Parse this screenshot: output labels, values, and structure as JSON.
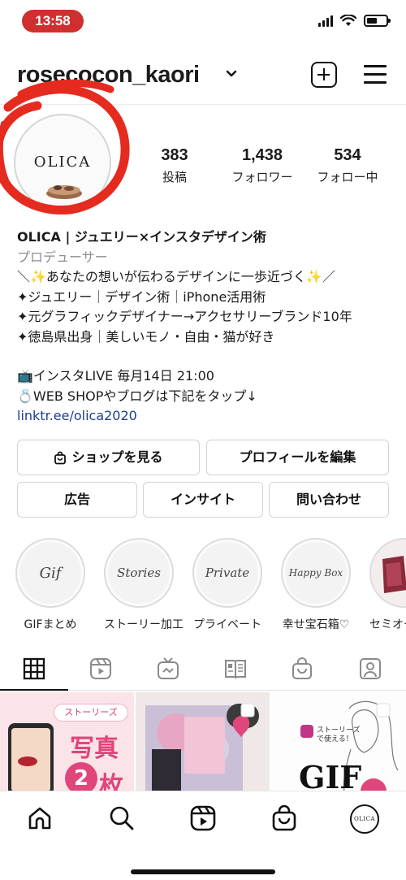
{
  "status_bar": {
    "time": "13:58"
  },
  "header": {
    "username": "rosecocon_kaori"
  },
  "avatar": {
    "text": "OLICA"
  },
  "stats": [
    {
      "value": "383",
      "label": "投稿"
    },
    {
      "value": "1,438",
      "label": "フォロワー"
    },
    {
      "value": "534",
      "label": "フォロー中"
    }
  ],
  "bio": {
    "name": "OLICA | ジュエリー×インスタデザイン術",
    "category": "プロデューサー",
    "lines": [
      "＼✨あなたの想いが伝わるデザインに一歩近づく✨／",
      "✦ジュエリー｜デザイン術｜iPhone活用術",
      "✦元グラフィックデザイナー→アクセサリーブランド10年",
      "✦徳島県出身｜美しいモノ・自由・猫が好き"
    ],
    "live_line": "📺インスタLIVE 毎月14日 21:00",
    "shop_line": "💍WEB SHOPやブログは下記をタップ↓",
    "link": "linktr.ee/olica2020"
  },
  "buttons": {
    "shop": "ショップを見る",
    "edit_profile": "プロフィールを編集",
    "ads": "広告",
    "insights": "インサイト",
    "contact": "問い合わせ"
  },
  "highlights": [
    {
      "cover": "Gif",
      "label": "GIFまとめ"
    },
    {
      "cover": "Stories",
      "label": "ストーリー加工"
    },
    {
      "cover": "Private",
      "label": "プライベート"
    },
    {
      "cover": "Happy Box",
      "label": "幸せ宝石箱♡"
    },
    {
      "cover": "",
      "label": "セミオー"
    }
  ],
  "grid": {
    "post1": {
      "badge": "ストーリーズ",
      "line1": "写真",
      "line2": "2",
      "line3": "枚"
    },
    "post3": {
      "badge": "ストーリーズで使える！",
      "text": "GIF"
    }
  },
  "colors": {
    "status_pill": "#cf2f2f",
    "link": "#1b3f8b",
    "accent_pink": "#e0457b",
    "brush_red": "#e52b1f"
  }
}
